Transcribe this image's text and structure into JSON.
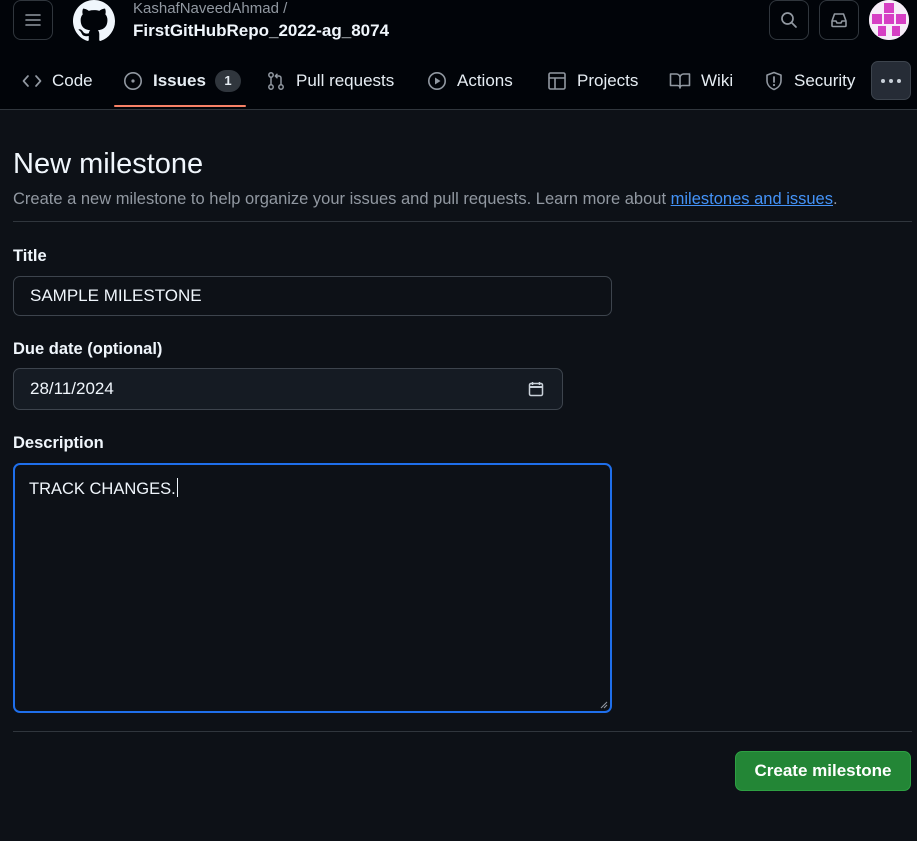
{
  "header": {
    "owner": "KashafNaveedAhmad /",
    "repo": "FirstGitHubRepo_2022-ag_8074"
  },
  "tabs": [
    {
      "label": "Code",
      "icon": "code-icon"
    },
    {
      "label": "Issues",
      "icon": "issue-opened-icon",
      "count": "1",
      "active": true
    },
    {
      "label": "Pull requests",
      "icon": "git-pull-request-icon"
    },
    {
      "label": "Actions",
      "icon": "play-icon"
    },
    {
      "label": "Projects",
      "icon": "table-icon"
    },
    {
      "label": "Wiki",
      "icon": "book-icon"
    },
    {
      "label": "Security",
      "icon": "shield-icon"
    }
  ],
  "page": {
    "title": "New milestone",
    "subtitle": "Create a new milestone to help organize your issues and pull requests. Learn more about ",
    "subtitle_link": "milestones and issues",
    "subtitle_end": "."
  },
  "form": {
    "title_label": "Title",
    "title_value": "SAMPLE MILESTONE",
    "due_label": "Due date (optional)",
    "due_value": "28/11/2024",
    "description_label": "Description",
    "description_value": "TRACK CHANGES.",
    "submit_label": "Create milestone"
  },
  "colors": {
    "background": "#0d1117",
    "header_bg": "#010409",
    "accent_link": "#4493f8",
    "active_tab_underline": "#f78166",
    "submit_green": "#238636",
    "focus_border": "#1f6feb"
  }
}
